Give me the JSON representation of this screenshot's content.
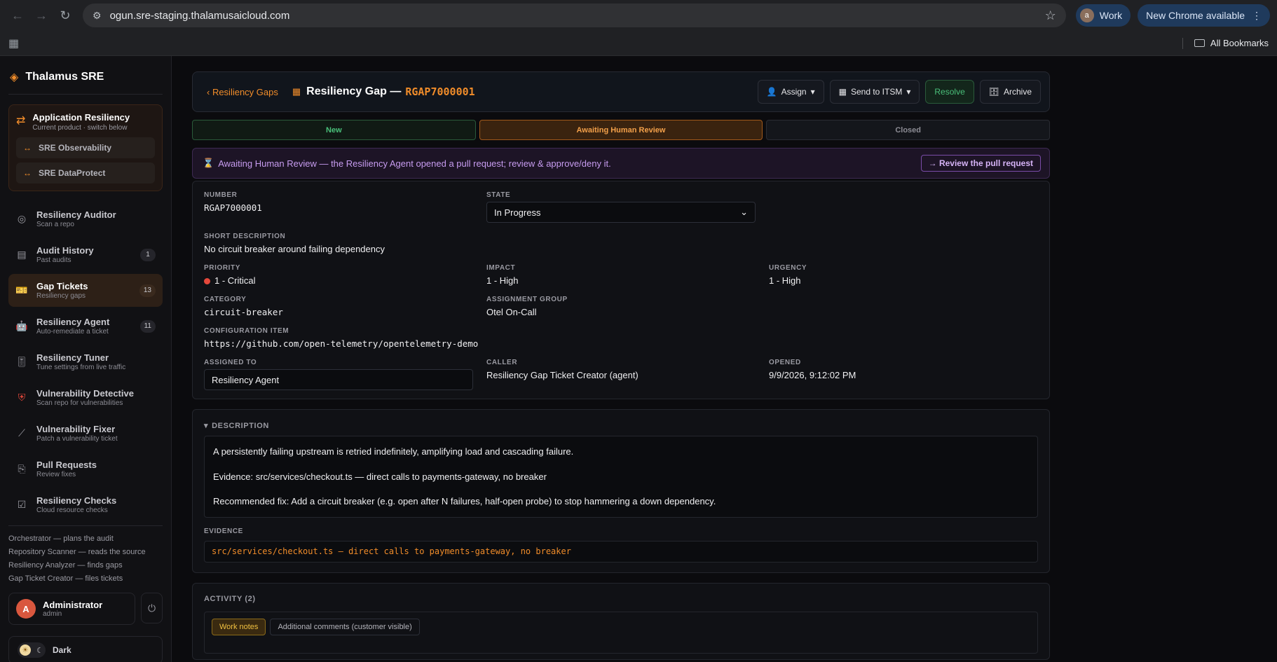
{
  "browser": {
    "url": "ogun.sre-staging.thalamusaicloud.com",
    "profile_label": "Work",
    "profile_initial": "a",
    "update_label": "New Chrome available",
    "bookmarks_label": "All Bookmarks"
  },
  "sidebar": {
    "brand": "Thalamus SRE",
    "product": {
      "title": "Application Resiliency",
      "subtitle": "Current product · switch below",
      "switch_options": [
        "SRE Observability",
        "SRE DataProtect"
      ]
    },
    "items": [
      {
        "title": "Resiliency Auditor",
        "subtitle": "Scan a repo",
        "badge": "",
        "icon": "target-icon"
      },
      {
        "title": "Audit History",
        "subtitle": "Past audits",
        "badge": "1",
        "icon": "list-icon"
      },
      {
        "title": "Gap Tickets",
        "subtitle": "Resiliency gaps",
        "badge": "13",
        "icon": "ticket-icon"
      },
      {
        "title": "Resiliency Agent",
        "subtitle": "Auto-remediate a ticket",
        "badge": "11",
        "icon": "robot-icon"
      },
      {
        "title": "Resiliency Tuner",
        "subtitle": "Tune settings from live traffic",
        "badge": "",
        "icon": "tuner-icon"
      },
      {
        "title": "Vulnerability Detective",
        "subtitle": "Scan repo for vulnerabilities",
        "badge": "",
        "icon": "shield-icon"
      },
      {
        "title": "Vulnerability Fixer",
        "subtitle": "Patch a vulnerability ticket",
        "badge": "",
        "icon": "bandage-icon"
      },
      {
        "title": "Pull Requests",
        "subtitle": "Review fixes",
        "badge": "",
        "icon": "pull-request-icon"
      },
      {
        "title": "Resiliency Checks",
        "subtitle": "Cloud resource checks",
        "badge": "",
        "icon": "checkbox-icon"
      }
    ],
    "agents": [
      "Orchestrator — plans the audit",
      "Repository Scanner — reads the source",
      "Resiliency Analyzer — finds gaps",
      "Gap Ticket Creator — files tickets"
    ],
    "user": {
      "name": "Administrator",
      "role": "admin",
      "initial": "A"
    },
    "theme_label": "Dark"
  },
  "header": {
    "breadcrumb": "‹ Resiliency Gaps",
    "title": "Resiliency Gap —",
    "number": "RGAP7000001",
    "actions": {
      "assign": "Assign",
      "send": "Send to ITSM",
      "resolve": "Resolve",
      "archive": "Archive"
    }
  },
  "stages": [
    "New",
    "Awaiting Human Review",
    "Closed"
  ],
  "banner": {
    "text": "Awaiting Human Review — the Resiliency Agent opened a pull request; review & approve/deny it.",
    "button": "→ Review the pull request"
  },
  "details": {
    "number_label": "NUMBER",
    "number": "RGAP7000001",
    "state_label": "STATE",
    "state": "In Progress",
    "short_desc_label": "SHORT DESCRIPTION",
    "short_desc": "No circuit breaker around failing dependency",
    "priority_label": "PRIORITY",
    "priority": "1 - Critical",
    "impact_label": "IMPACT",
    "impact": "1 - High",
    "urgency_label": "URGENCY",
    "urgency": "1 - High",
    "category_label": "CATEGORY",
    "category": "circuit-breaker",
    "group_label": "ASSIGNMENT GROUP",
    "group": "Otel On-Call",
    "ci_label": "CONFIGURATION ITEM",
    "ci": "https://github.com/open-telemetry/opentelemetry-demo",
    "assigned_label": "ASSIGNED TO",
    "assigned": "Resiliency Agent",
    "caller_label": "CALLER",
    "caller": "Resiliency Gap Ticket Creator (agent)",
    "opened_label": "OPENED",
    "opened": "9/9/2026, 9:12:02 PM"
  },
  "description": {
    "label": "DESCRIPTION",
    "paragraphs": [
      "A persistently failing upstream is retried indefinitely, amplifying load and cascading failure.",
      "Evidence: src/services/checkout.ts — direct calls to payments-gateway, no breaker",
      "Recommended fix: Add a circuit breaker (e.g. open after N failures, half-open probe) to stop hammering a down dependency."
    ],
    "evidence_label": "EVIDENCE",
    "evidence": "src/services/checkout.ts — direct calls to payments-gateway, no breaker"
  },
  "activity": {
    "title": "ACTIVITY (2)",
    "tabs": [
      "Work notes",
      "Additional comments (customer visible)"
    ]
  }
}
